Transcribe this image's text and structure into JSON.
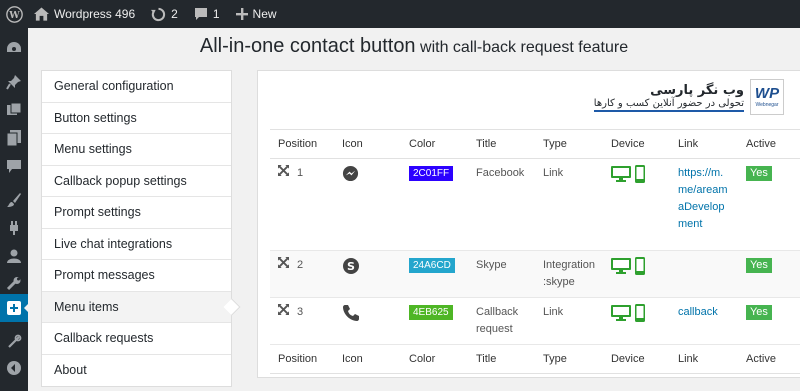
{
  "adminbar": {
    "site_name": "Wordpress 496",
    "updates_count": "2",
    "comments_count": "1",
    "new_label": "New"
  },
  "page": {
    "title_main": "All-in-one contact button",
    "title_sub": "with call-back request feature"
  },
  "left_menu": [
    {
      "label": "General configuration"
    },
    {
      "label": "Button settings"
    },
    {
      "label": "Menu settings"
    },
    {
      "label": "Callback popup settings"
    },
    {
      "label": "Prompt settings"
    },
    {
      "label": "Live chat integrations"
    },
    {
      "label": "Prompt messages"
    },
    {
      "label": "Menu items",
      "active": true
    },
    {
      "label": "Callback requests"
    },
    {
      "label": "About"
    }
  ],
  "logo": {
    "line1": "وب نگر پارسی",
    "line2": "تحولی در حضور آنلاین کسب و کارها",
    "mark": "WP",
    "mark_sub": "Webnegar"
  },
  "table": {
    "headers": [
      "Position",
      "Icon",
      "Color",
      "Title",
      "Type",
      "Device",
      "Link",
      "Active"
    ],
    "rows": [
      {
        "position": "1",
        "icon": "messenger-icon",
        "color": "2C01FF",
        "title": "Facebook",
        "type": "Link",
        "link": "https://m.me/areamaDevelopment",
        "active": "Yes"
      },
      {
        "position": "2",
        "icon": "skype-icon",
        "color": "24A6CD",
        "title": "Skype",
        "type": "Integration :skype",
        "link": "",
        "active": "Yes"
      },
      {
        "position": "3",
        "icon": "phone-icon",
        "color": "4EB625",
        "title": "Callback request",
        "type": "Link",
        "link": "callback",
        "active": "Yes"
      }
    ]
  },
  "colors": {
    "accent": "#0073aa",
    "active_badge": "#46b450",
    "device_icons": "#2ea02e"
  }
}
